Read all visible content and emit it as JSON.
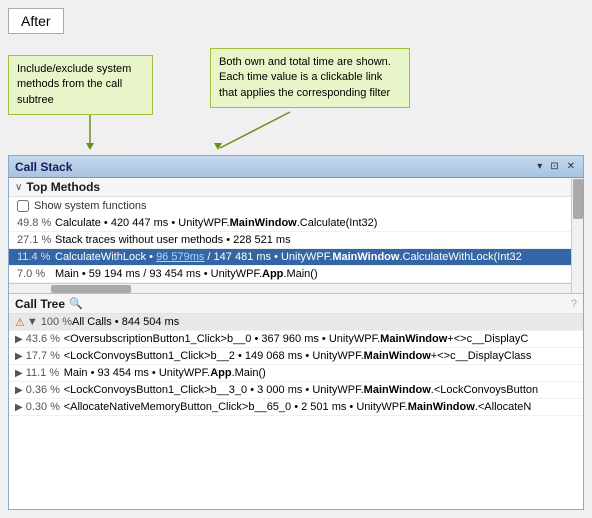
{
  "after_label": "After",
  "tooltips": {
    "left": {
      "text": "Include/exclude system methods from the call subtree"
    },
    "right": {
      "text": "Both own and total time are shown. Each time value is a clickable link that applies the corresponding filter"
    }
  },
  "panel": {
    "title": "Call Stack",
    "controls": {
      "pin": "▾",
      "float": "⊡",
      "close": "✕"
    },
    "top_methods": {
      "title": "Top Methods",
      "help": "?",
      "checkbox_label": "Show system functions",
      "rows": [
        {
          "percent": "49.8 %",
          "content": "Calculate • 420 447 ms • UnityWPF.",
          "bold": "MainWindow",
          "content2": ".Calculate(Int32)",
          "selected": false
        },
        {
          "percent": "27.1 %",
          "content": "Stack traces without user methods • 228 521 ms",
          "selected": false
        },
        {
          "percent": "11.4 %",
          "content": "CalculateWithLock • ",
          "link": "96 579ms",
          "content2": " / 147 481 ms • UnityWPF.",
          "bold": "MainWindow",
          "content3": ".CalculateWithLock(Int32",
          "selected": true
        },
        {
          "percent": "7.0 %",
          "content": "Main • 59 194 ms / 93 454 ms • UnityWPF.",
          "bold": "App",
          "content2": ".Main()",
          "selected": false
        }
      ]
    },
    "call_tree": {
      "title": "Call Tree",
      "help": "?",
      "rows": [
        {
          "type": "header",
          "warning": true,
          "percent": "▼ 100 %",
          "content": "All Calls • 844 504 ms"
        },
        {
          "type": "item",
          "indent": 0,
          "arrow": "▶",
          "percent": "43.6 %",
          "content": "<OversubscriptionButton1_Click>b__0 • 367 960 ms • UnityWPF.",
          "bold": "MainWindow",
          "content2": "+<>c__DisplayCla"
        },
        {
          "type": "item",
          "indent": 0,
          "arrow": "▶",
          "percent": "17.7 %",
          "content": "<LockConvoysButton1_Click>b__2 • 149 068 ms • UnityWPF.",
          "bold": "MainWindow",
          "content2": "+<>c__DisplayClass"
        },
        {
          "type": "item",
          "indent": 0,
          "arrow": "▶",
          "percent": "11.1 %",
          "content": "Main • 93 454 ms • UnityWPF.",
          "bold": "App",
          "content2": ".Main()"
        },
        {
          "type": "item",
          "indent": 0,
          "arrow": "▶",
          "percent": "0.36 %",
          "content": "<LockConvoysButton1_Click>b__3_0 • 3 000 ms • UnityWPF.",
          "bold": "MainWindow",
          "content2": ".<LockConvoysButton"
        },
        {
          "type": "item",
          "indent": 0,
          "arrow": "▶",
          "percent": "0.30 %",
          "content": "<AllocateNativeMemoryButton_Click>b__65_0 • 2 501 ms • UnityWPF.",
          "bold": "MainWindow",
          "content2": ".<AllocateN"
        }
      ]
    }
  }
}
